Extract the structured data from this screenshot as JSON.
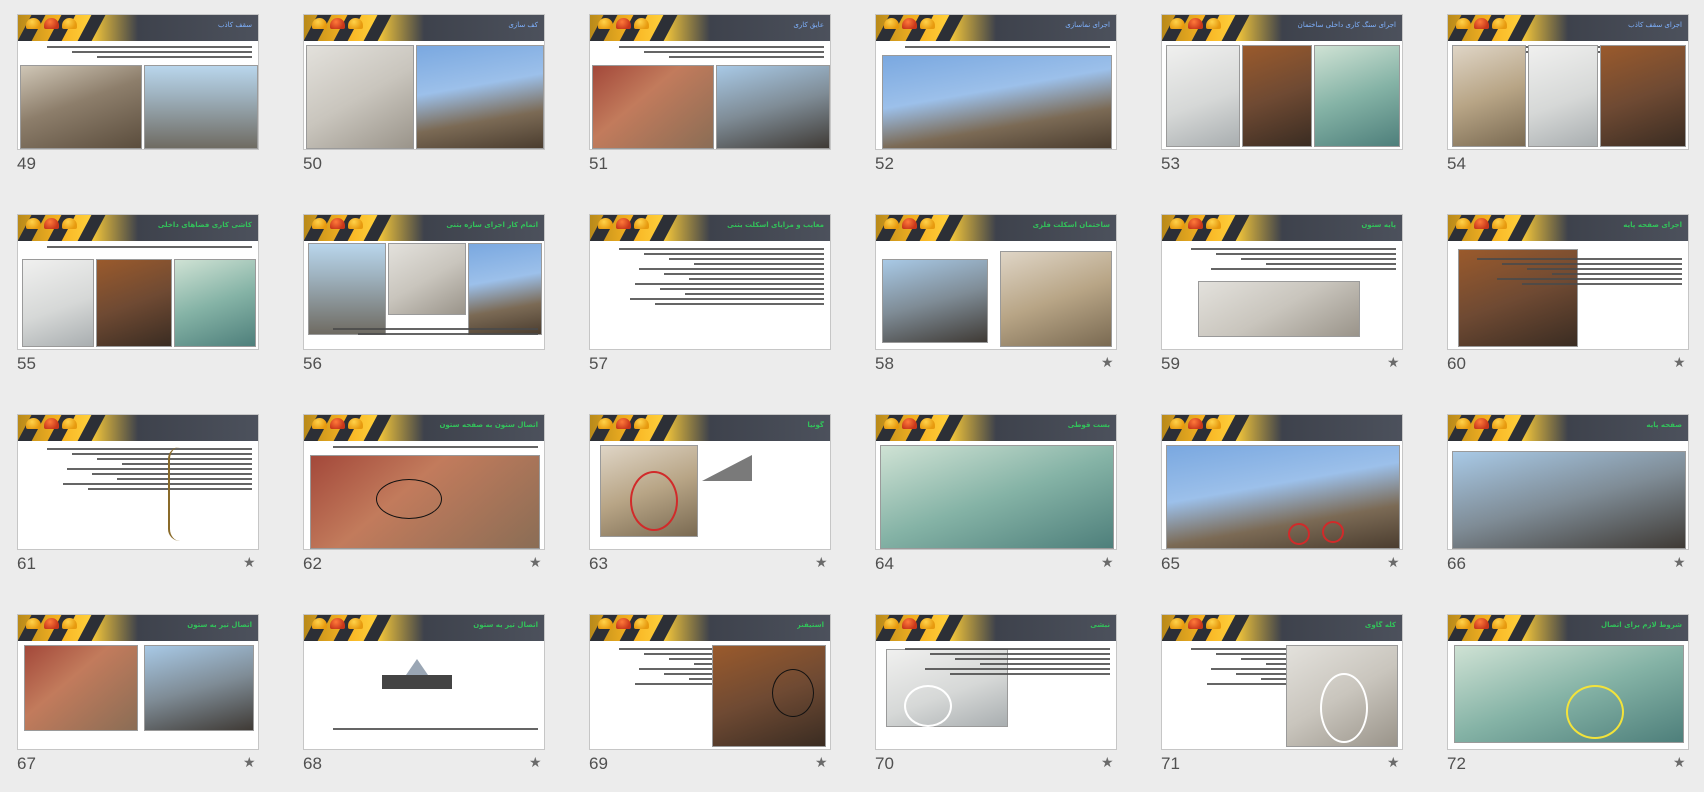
{
  "slides": [
    {
      "number": "49",
      "title": "سقف کاذب",
      "starred": false
    },
    {
      "number": "50",
      "title": "کف سازی",
      "starred": false
    },
    {
      "number": "51",
      "title": "عایق کاری",
      "starred": false
    },
    {
      "number": "52",
      "title": "اجرای نماسازی",
      "starred": false
    },
    {
      "number": "53",
      "title": "اجرای سنگ کاری داخلی ساختمان",
      "starred": false
    },
    {
      "number": "54",
      "title": "اجرای سقف کاذب",
      "starred": false
    },
    {
      "number": "55",
      "title": "کاشی کاری فضاهای داخلی",
      "starred": false
    },
    {
      "number": "56",
      "title": "اتمام کار اجرای سازه بتنی",
      "starred": false
    },
    {
      "number": "57",
      "title": "معایب و مزایای اسکلت بتنی",
      "starred": false
    },
    {
      "number": "58",
      "title": "ساختمان اسکلت فلزی",
      "starred": true
    },
    {
      "number": "59",
      "title": "پایه ستون",
      "starred": true
    },
    {
      "number": "60",
      "title": "اجرای صفحه پایه",
      "starred": true
    },
    {
      "number": "61",
      "title": "",
      "starred": true
    },
    {
      "number": "62",
      "title": "اتصال ستون به صفحه ستون",
      "starred": true
    },
    {
      "number": "63",
      "title": "گونیا",
      "starred": true
    },
    {
      "number": "64",
      "title": "بست قوطی",
      "starred": true
    },
    {
      "number": "65",
      "title": "",
      "starred": true
    },
    {
      "number": "66",
      "title": "صفحه پایه",
      "starred": true
    },
    {
      "number": "67",
      "title": "اتصال تیر به ستون",
      "starred": true
    },
    {
      "number": "68",
      "title": "اتصال تیر به ستون",
      "starred": true
    },
    {
      "number": "69",
      "title": "استیفنر",
      "starred": true
    },
    {
      "number": "70",
      "title": "نبشی",
      "starred": true
    },
    {
      "number": "71",
      "title": "کله گاوی",
      "starred": true
    },
    {
      "number": "72",
      "title": "شروط لازم برای اتصال",
      "starred": true
    }
  ],
  "icons": {
    "star": "star-icon"
  },
  "colors": {
    "background": "#ececec",
    "banner_dark": "#2a2d35",
    "banner_yellow": "#f7b322",
    "title_blue": "#7fb2ff",
    "title_green": "#32c25a"
  }
}
